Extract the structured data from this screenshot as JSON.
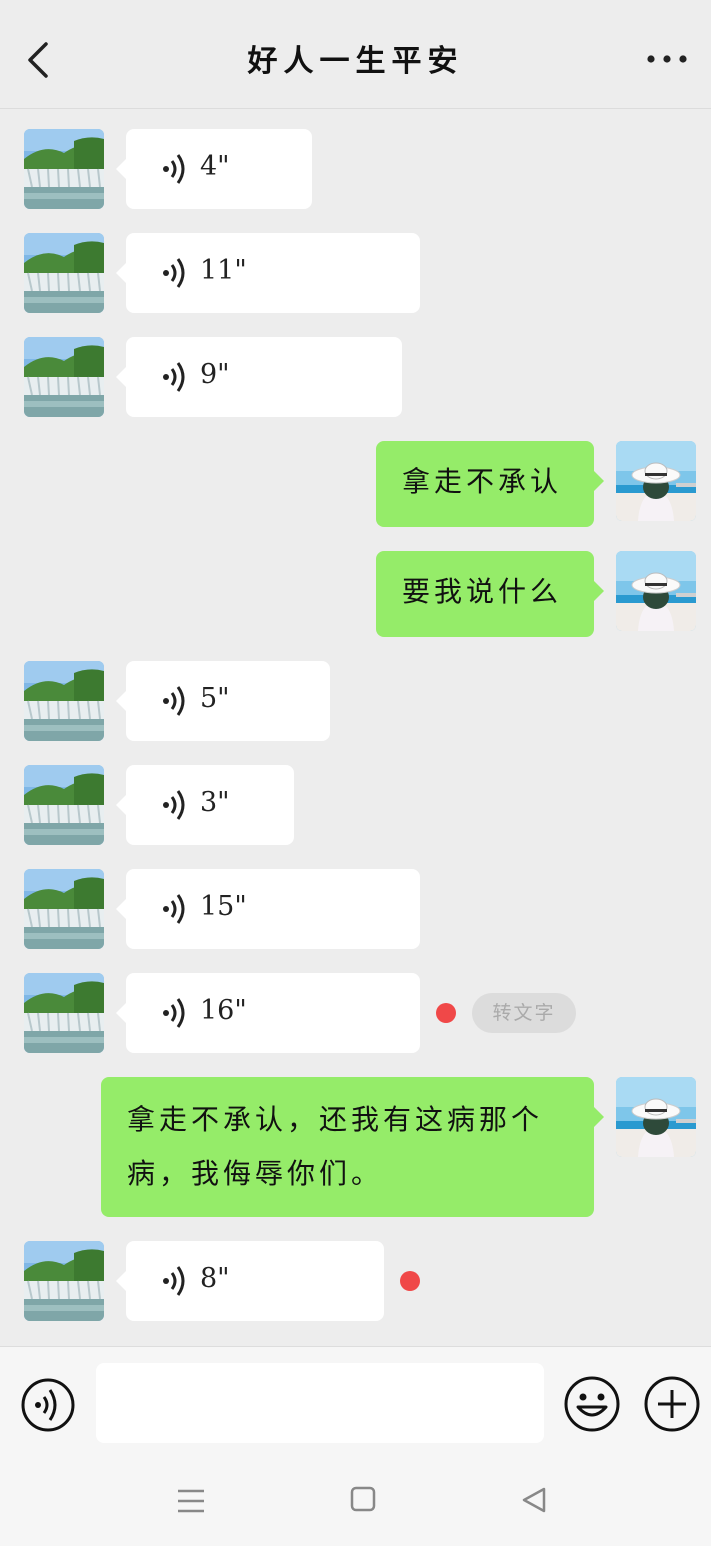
{
  "header": {
    "title": "好人一生平安",
    "back_icon": "chevron-left-icon",
    "more_icon": "more-dots-icon"
  },
  "messages": [
    {
      "side": "left",
      "type": "voice",
      "duration": "4\""
    },
    {
      "side": "left",
      "type": "voice",
      "duration": "11\""
    },
    {
      "side": "left",
      "type": "voice",
      "duration": "9\""
    },
    {
      "side": "right",
      "type": "text",
      "text": "拿走不承认"
    },
    {
      "side": "right",
      "type": "text",
      "text": "要我说什么"
    },
    {
      "side": "left",
      "type": "voice",
      "duration": "5\""
    },
    {
      "side": "left",
      "type": "voice",
      "duration": "3\""
    },
    {
      "side": "left",
      "type": "voice",
      "duration": "15\""
    },
    {
      "side": "left",
      "type": "voice",
      "duration": "16\"",
      "unread": true,
      "convert_label": "转文字"
    },
    {
      "side": "right",
      "type": "text",
      "text": "拿走不承认，还我有这病那个病，我侮辱你们。"
    },
    {
      "side": "left",
      "type": "voice",
      "duration": "8\"",
      "unread": true
    }
  ],
  "input": {
    "value": "",
    "voice_icon": "voice-toggle-icon",
    "emoji_icon": "emoji-icon",
    "plus_icon": "plus-icon"
  },
  "navbar": {
    "menu_icon": "menu-icon",
    "home_icon": "home-square-icon",
    "back_icon": "back-triangle-icon"
  },
  "colors": {
    "background": "#ededed",
    "sent_bubble": "#95ec69",
    "received_bubble": "#ffffff",
    "unread_dot": "#f04848"
  }
}
